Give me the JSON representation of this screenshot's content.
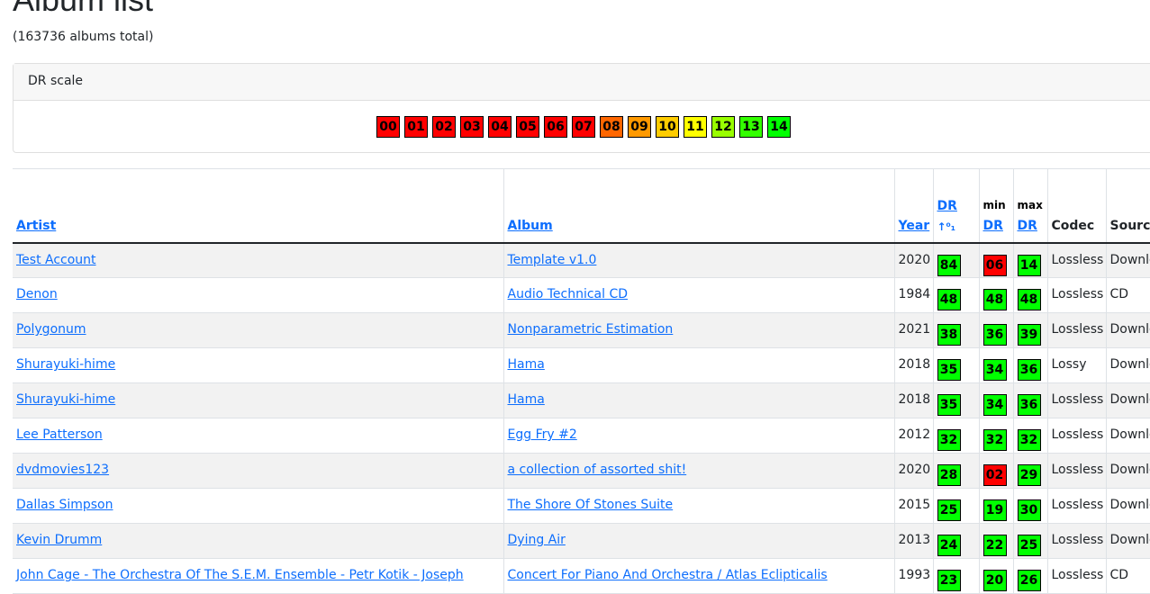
{
  "page": {
    "title": "Album list",
    "total_text": "(163736 albums total)"
  },
  "dr_scale": {
    "header": "DR scale",
    "items": [
      {
        "label": "00",
        "color": "#ff0000"
      },
      {
        "label": "01",
        "color": "#ff0000"
      },
      {
        "label": "02",
        "color": "#ff0000"
      },
      {
        "label": "03",
        "color": "#ff0000"
      },
      {
        "label": "04",
        "color": "#ff0000"
      },
      {
        "label": "05",
        "color": "#ff0000"
      },
      {
        "label": "06",
        "color": "#ff0000"
      },
      {
        "label": "07",
        "color": "#ff0000"
      },
      {
        "label": "08",
        "color": "#ff6600"
      },
      {
        "label": "09",
        "color": "#ff9900"
      },
      {
        "label": "10",
        "color": "#ffcc00"
      },
      {
        "label": "11",
        "color": "#ffff00"
      },
      {
        "label": "12",
        "color": "#99ff00"
      },
      {
        "label": "13",
        "color": "#33ff00"
      },
      {
        "label": "14",
        "color": "#00ff00"
      }
    ]
  },
  "table": {
    "headers": {
      "artist": "Artist",
      "album": "Album",
      "year": "Year",
      "dr": "DR",
      "dr_sort": "↑⁰₁",
      "min_top": "min",
      "min": "DR",
      "max_top": "max",
      "max": "DR",
      "codec": "Codec",
      "source": "Source"
    },
    "rows": [
      {
        "artist": "Test Account",
        "album": "Template v1.0",
        "year": "2020",
        "dr": "84",
        "dr_color": "#00ff00",
        "min": "06",
        "min_color": "#ff0000",
        "max": "14",
        "max_color": "#00ff00",
        "codec": "Lossless",
        "source": "Download"
      },
      {
        "artist": "Denon",
        "album": "Audio Technical CD",
        "year": "1984",
        "dr": "48",
        "dr_color": "#00ff00",
        "min": "48",
        "min_color": "#00ff00",
        "max": "48",
        "max_color": "#00ff00",
        "codec": "Lossless",
        "source": "CD"
      },
      {
        "artist": "Polygonum",
        "album": "Nonparametric Estimation",
        "year": "2021",
        "dr": "38",
        "dr_color": "#00ff00",
        "min": "36",
        "min_color": "#00ff00",
        "max": "39",
        "max_color": "#00ff00",
        "codec": "Lossless",
        "source": "Download"
      },
      {
        "artist": "Shurayuki-hime",
        "album": "Hama",
        "year": "2018",
        "dr": "35",
        "dr_color": "#00ff00",
        "min": "34",
        "min_color": "#00ff00",
        "max": "36",
        "max_color": "#00ff00",
        "codec": "Lossy",
        "source": "Download"
      },
      {
        "artist": "Shurayuki-hime",
        "album": "Hama",
        "year": "2018",
        "dr": "35",
        "dr_color": "#00ff00",
        "min": "34",
        "min_color": "#00ff00",
        "max": "36",
        "max_color": "#00ff00",
        "codec": "Lossless",
        "source": "Download"
      },
      {
        "artist": "Lee Patterson",
        "album": "Egg Fry #2",
        "year": "2012",
        "dr": "32",
        "dr_color": "#00ff00",
        "min": "32",
        "min_color": "#00ff00",
        "max": "32",
        "max_color": "#00ff00",
        "codec": "Lossless",
        "source": "Download"
      },
      {
        "artist": "dvdmovies123",
        "album": "a collection of assorted shit!",
        "year": "2020",
        "dr": "28",
        "dr_color": "#00ff00",
        "min": "02",
        "min_color": "#ff0000",
        "max": "29",
        "max_color": "#00ff00",
        "codec": "Lossless",
        "source": "Download"
      },
      {
        "artist": "Dallas Simpson",
        "album": "The Shore Of Stones Suite",
        "year": "2015",
        "dr": "25",
        "dr_color": "#00ff00",
        "min": "19",
        "min_color": "#00ff00",
        "max": "30",
        "max_color": "#00ff00",
        "codec": "Lossless",
        "source": "Download"
      },
      {
        "artist": "Kevin Drumm",
        "album": "Dying Air",
        "year": "2013",
        "dr": "24",
        "dr_color": "#00ff00",
        "min": "22",
        "min_color": "#00ff00",
        "max": "25",
        "max_color": "#00ff00",
        "codec": "Lossless",
        "source": "Download"
      },
      {
        "artist": "John Cage - The Orchestra Of The S.E.M. Ensemble - Petr Kotik - Joseph",
        "album": "Concert For Piano And Orchestra / Atlas Eclipticalis",
        "year": "1993",
        "dr": "23",
        "dr_color": "#00ff00",
        "min": "20",
        "min_color": "#00ff00",
        "max": "26",
        "max_color": "#00ff00",
        "codec": "Lossless",
        "source": "CD"
      }
    ]
  }
}
